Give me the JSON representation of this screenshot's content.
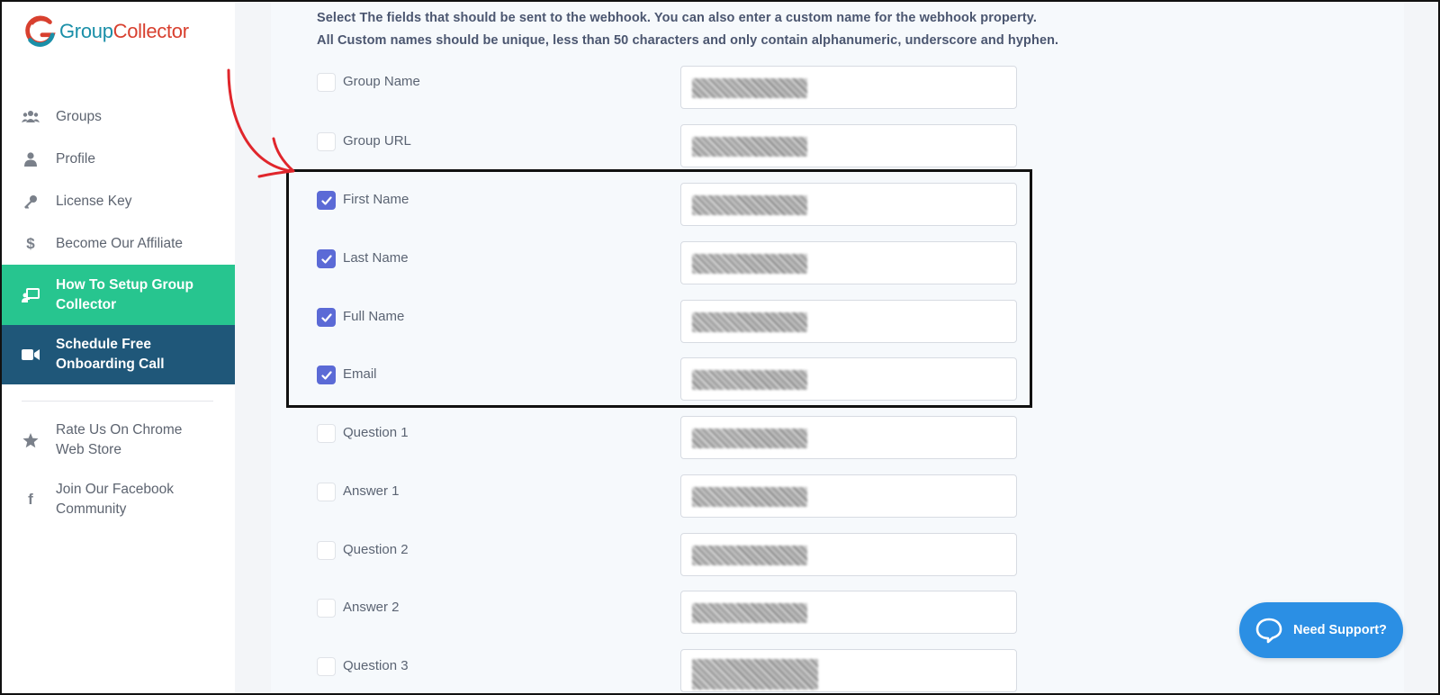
{
  "logo": {
    "part1": "Group",
    "part2": "Collector"
  },
  "sidebar": {
    "items": [
      {
        "label": "Groups",
        "icon": "users-icon"
      },
      {
        "label": "Profile",
        "icon": "user-icon"
      },
      {
        "label": "License Key",
        "icon": "key-icon"
      },
      {
        "label": "Become Our Affiliate",
        "icon": "dollar-icon"
      },
      {
        "label_line1": "How To Setup Group",
        "label_line2": "Collector",
        "icon": "chalkboard-teacher-icon"
      },
      {
        "label_line1": "Schedule Free",
        "label_line2": "Onboarding Call",
        "icon": "video-icon"
      }
    ],
    "secondary": [
      {
        "label_line1": "Rate Us On Chrome",
        "label_line2": "Web Store",
        "icon": "star-icon"
      },
      {
        "label_line1": "Join Our Facebook",
        "label_line2": "Community",
        "icon": "facebook-icon"
      }
    ]
  },
  "main": {
    "instruction_line1": "Select The fields that should be sent to the webhook. You can also enter a custom name for the webhook property.",
    "instruction_line2": "All Custom names should be unique, less than 50 characters and only contain alphanumeric, underscore and hyphen.",
    "fields": [
      {
        "label": "Group Name",
        "checked": false
      },
      {
        "label": "Group URL",
        "checked": false
      },
      {
        "label": "First Name",
        "checked": true
      },
      {
        "label": "Last Name",
        "checked": true
      },
      {
        "label": "Full Name",
        "checked": true
      },
      {
        "label": "Email",
        "checked": true
      },
      {
        "label": "Question 1",
        "checked": false
      },
      {
        "label": "Answer 1",
        "checked": false
      },
      {
        "label": "Question 2",
        "checked": false
      },
      {
        "label": "Answer 2",
        "checked": false
      },
      {
        "label": "Question 3",
        "checked": false
      }
    ]
  },
  "support": {
    "label": "Need Support?"
  },
  "colors": {
    "brand_teal": "#1a8fa8",
    "brand_red": "#d8402f",
    "active_green": "#27c58f",
    "active_blue": "#1f5779",
    "checkbox": "#5b6ad6",
    "support": "#2b8fe4"
  }
}
